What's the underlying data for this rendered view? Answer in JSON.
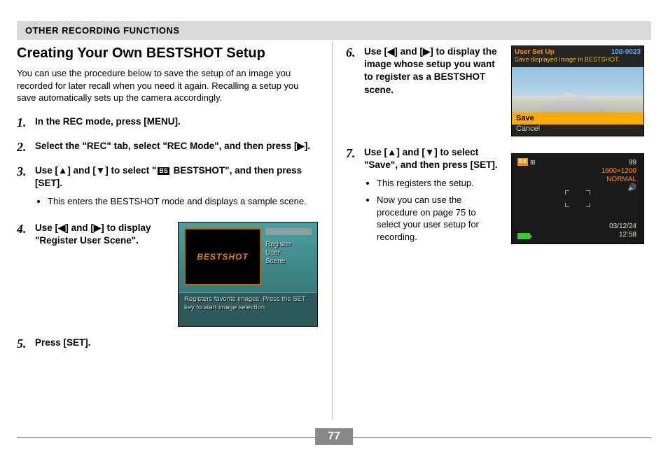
{
  "header": "OTHER RECORDING FUNCTIONS",
  "title": "Creating Your Own BESTSHOT Setup",
  "intro": "You can use the procedure below to save the setup of an image you recorded for later recall when you need it again. Recalling a setup you save automatically sets up the camera accordingly.",
  "steps": {
    "s1": "In the REC mode, press [MENU].",
    "s2": "Select the \"REC\" tab, select \"REC Mode\", and then press [▶].",
    "s3": "Use [▲] and [▼] to select \" BS  BESTSHOT\", and then press [SET].",
    "s3_bullet": "This enters the BESTSHOT mode and displays a sample scene.",
    "s4": "Use [◀] and [▶] to display \"Register User Scene\".",
    "s5": "Press [SET].",
    "s6": "Use [◀] and [▶] to display the image whose setup you want to register as a BESTSHOT scene.",
    "s7": "Use [▲] and [▼] to select \"Save\", and then press [SET].",
    "s7_b1": "This registers the setup.",
    "s7_b2": "Now you can use the procedure on page 75 to select your user setup for recording."
  },
  "fig1": {
    "logo": "BESTSHOT",
    "label": "Register\nUser\nScene",
    "caption": "Registers favorite images. Press the SET key to start image selection."
  },
  "fig2": {
    "title": "User Set Up",
    "id": "100-0023",
    "msg": "Save displayed image in BESTSHOT.",
    "save": "Save",
    "cancel": "Cancel"
  },
  "fig3": {
    "bs": "BS",
    "count": "99",
    "res": "1600×1200",
    "normal": "NORMAL",
    "date": "03/12/24",
    "time": "12:58"
  },
  "page_number": "77"
}
